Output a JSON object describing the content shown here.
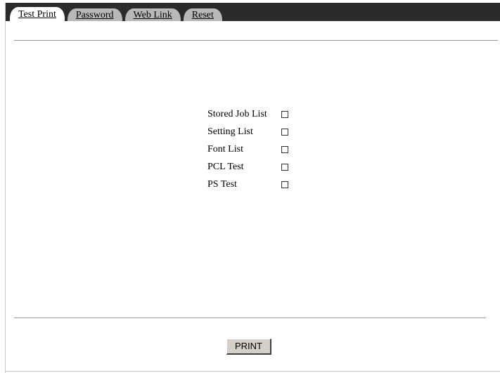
{
  "tabs": [
    {
      "label": "Test Print",
      "active": true
    },
    {
      "label": "Password",
      "active": false
    },
    {
      "label": "Web Link",
      "active": false
    },
    {
      "label": "Reset",
      "active": false
    }
  ],
  "options": [
    {
      "label": "Stored Job List",
      "checked": false
    },
    {
      "label": "Setting List",
      "checked": false
    },
    {
      "label": "Font List",
      "checked": false
    },
    {
      "label": "PCL Test",
      "checked": false
    },
    {
      "label": "PS Test",
      "checked": false
    }
  ],
  "print_button": {
    "label": "PRINT"
  },
  "colors": {
    "tab_strip": "#2b2b2b",
    "inactive_tab": "#b8b8b8",
    "active_tab": "#ffffff",
    "button_face": "#d4d0c8"
  }
}
